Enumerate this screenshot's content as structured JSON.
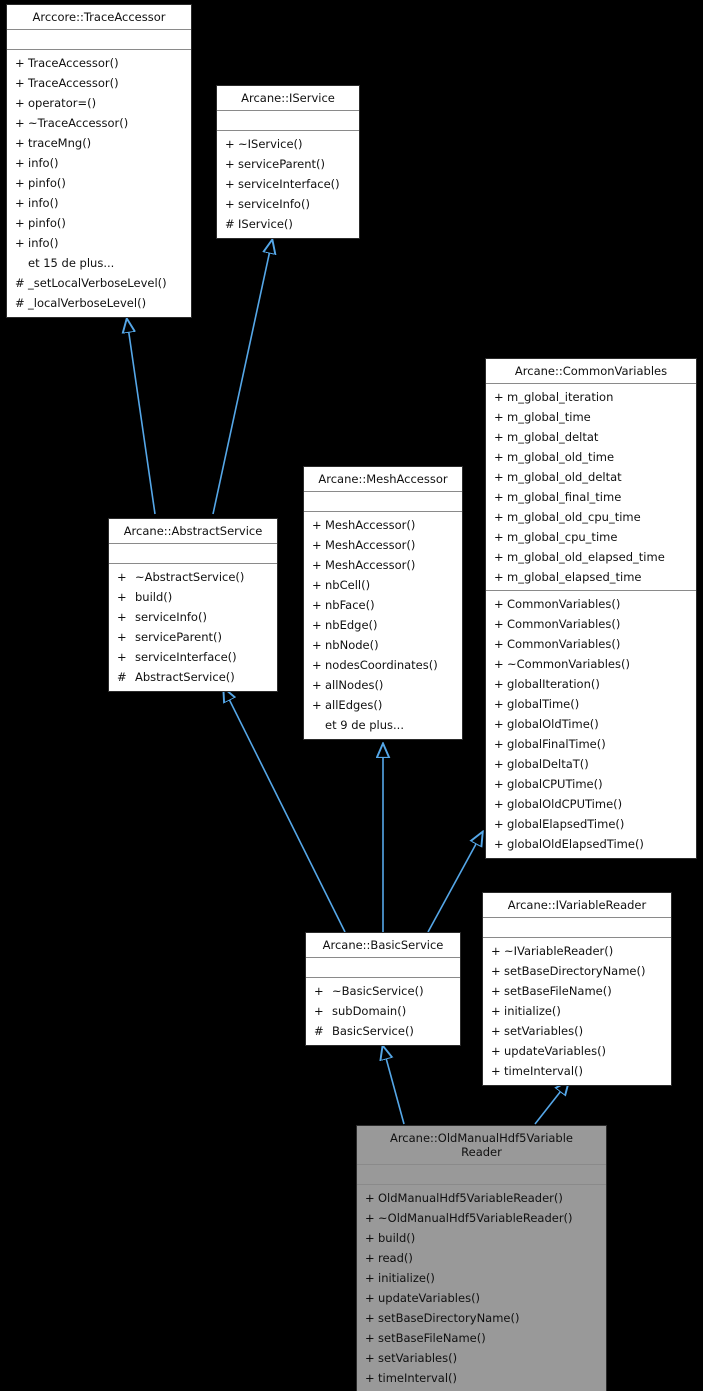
{
  "diagram": {
    "title": "Arcane::OldManualHdf5VariableReader class hierarchy",
    "background_color": "#000000",
    "edge_color": "#55a7e8",
    "box_fill": "#ffffff",
    "highlight_fill": "#999999",
    "more_label_15": "et 15 de plus...",
    "more_label_9": "et 9 de plus..."
  },
  "classes": {
    "trace_accessor": {
      "name": "Arccore::TraceAccessor",
      "attributes": [],
      "operations": [
        {
          "vis": "+",
          "label": "TraceAccessor()"
        },
        {
          "vis": "+",
          "label": "TraceAccessor()"
        },
        {
          "vis": "+",
          "label": "operator=()"
        },
        {
          "vis": "+",
          "label": "~TraceAccessor()"
        },
        {
          "vis": "+",
          "label": "traceMng()"
        },
        {
          "vis": "+",
          "label": "info()"
        },
        {
          "vis": "+",
          "label": "pinfo()"
        },
        {
          "vis": "+",
          "label": "info()"
        },
        {
          "vis": "+",
          "label": "pinfo()"
        },
        {
          "vis": "+",
          "label": "info()"
        },
        {
          "vis": "",
          "label": "et 15 de plus..."
        },
        {
          "vis": "#",
          "label": "_setLocalVerboseLevel()"
        },
        {
          "vis": "#",
          "label": "_localVerboseLevel()"
        }
      ]
    },
    "iservice": {
      "name": "Arcane::IService",
      "attributes": [],
      "operations": [
        {
          "vis": "+",
          "label": "~IService()"
        },
        {
          "vis": "+",
          "label": "serviceParent()"
        },
        {
          "vis": "+",
          "label": "serviceInterface()"
        },
        {
          "vis": "+",
          "label": "serviceInfo()"
        },
        {
          "vis": "#",
          "label": "IService()"
        }
      ]
    },
    "common_variables": {
      "name": "Arcane::CommonVariables",
      "attributes": [
        {
          "vis": "+",
          "label": "m_global_iteration"
        },
        {
          "vis": "+",
          "label": "m_global_time"
        },
        {
          "vis": "+",
          "label": "m_global_deltat"
        },
        {
          "vis": "+",
          "label": "m_global_old_time"
        },
        {
          "vis": "+",
          "label": "m_global_old_deltat"
        },
        {
          "vis": "+",
          "label": "m_global_final_time"
        },
        {
          "vis": "+",
          "label": "m_global_old_cpu_time"
        },
        {
          "vis": "+",
          "label": "m_global_cpu_time"
        },
        {
          "vis": "+",
          "label": "m_global_old_elapsed_time"
        },
        {
          "vis": "+",
          "label": "m_global_elapsed_time"
        }
      ],
      "operations": [
        {
          "vis": "+",
          "label": "CommonVariables()"
        },
        {
          "vis": "+",
          "label": "CommonVariables()"
        },
        {
          "vis": "+",
          "label": "CommonVariables()"
        },
        {
          "vis": "+",
          "label": "~CommonVariables()"
        },
        {
          "vis": "+",
          "label": "globalIteration()"
        },
        {
          "vis": "+",
          "label": "globalTime()"
        },
        {
          "vis": "+",
          "label": "globalOldTime()"
        },
        {
          "vis": "+",
          "label": "globalFinalTime()"
        },
        {
          "vis": "+",
          "label": "globalDeltaT()"
        },
        {
          "vis": "+",
          "label": "globalCPUTime()"
        },
        {
          "vis": "+",
          "label": "globalOldCPUTime()"
        },
        {
          "vis": "+",
          "label": "globalElapsedTime()"
        },
        {
          "vis": "+",
          "label": "globalOldElapsedTime()"
        }
      ]
    },
    "mesh_accessor": {
      "name": "Arcane::MeshAccessor",
      "attributes": [],
      "operations": [
        {
          "vis": "+",
          "label": "MeshAccessor()"
        },
        {
          "vis": "+",
          "label": "MeshAccessor()"
        },
        {
          "vis": "+",
          "label": "MeshAccessor()"
        },
        {
          "vis": "+",
          "label": "nbCell()"
        },
        {
          "vis": "+",
          "label": "nbFace()"
        },
        {
          "vis": "+",
          "label": "nbEdge()"
        },
        {
          "vis": "+",
          "label": "nbNode()"
        },
        {
          "vis": "+",
          "label": "nodesCoordinates()"
        },
        {
          "vis": "+",
          "label": "allNodes()"
        },
        {
          "vis": "+",
          "label": "allEdges()"
        },
        {
          "vis": "",
          "label": "et 9 de plus..."
        }
      ]
    },
    "abstract_service": {
      "name": "Arcane::AbstractService",
      "attributes": [],
      "operations": [
        {
          "vis": "+",
          "label": "~AbstractService()"
        },
        {
          "vis": "+",
          "label": "build()"
        },
        {
          "vis": "+",
          "label": "serviceInfo()"
        },
        {
          "vis": "+",
          "label": "serviceParent()"
        },
        {
          "vis": "+",
          "label": "serviceInterface()"
        },
        {
          "vis": "#",
          "label": "AbstractService()"
        }
      ]
    },
    "basic_service": {
      "name": "Arcane::BasicService",
      "attributes": [],
      "operations": [
        {
          "vis": "+",
          "label": "~BasicService()"
        },
        {
          "vis": "+",
          "label": "subDomain()"
        },
        {
          "vis": "#",
          "label": "BasicService()"
        }
      ]
    },
    "ivariable_reader": {
      "name": "Arcane::IVariableReader",
      "attributes": [],
      "operations": [
        {
          "vis": "+",
          "label": "~IVariableReader()"
        },
        {
          "vis": "+",
          "label": "setBaseDirectoryName()"
        },
        {
          "vis": "+",
          "label": "setBaseFileName()"
        },
        {
          "vis": "+",
          "label": "initialize()"
        },
        {
          "vis": "+",
          "label": "setVariables()"
        },
        {
          "vis": "+",
          "label": "updateVariables()"
        },
        {
          "vis": "+",
          "label": "timeInterval()"
        }
      ]
    },
    "old_manual_hdf5_variable_reader": {
      "name": "Arcane::OldManualHdf5Variable\nReader",
      "attributes": [],
      "operations": [
        {
          "vis": "+",
          "label": "OldManualHdf5VariableReader()"
        },
        {
          "vis": "+",
          "label": "~OldManualHdf5VariableReader()"
        },
        {
          "vis": "+",
          "label": "build()"
        },
        {
          "vis": "+",
          "label": "read()"
        },
        {
          "vis": "+",
          "label": "initialize()"
        },
        {
          "vis": "+",
          "label": "updateVariables()"
        },
        {
          "vis": "+",
          "label": "setBaseDirectoryName()"
        },
        {
          "vis": "+",
          "label": "setBaseFileName()"
        },
        {
          "vis": "+",
          "label": "setVariables()"
        },
        {
          "vis": "+",
          "label": "timeInterval()"
        }
      ]
    }
  },
  "inheritance_edges": [
    {
      "from": "abstract_service",
      "to": "trace_accessor"
    },
    {
      "from": "abstract_service",
      "to": "iservice"
    },
    {
      "from": "basic_service",
      "to": "abstract_service"
    },
    {
      "from": "basic_service",
      "to": "mesh_accessor"
    },
    {
      "from": "basic_service",
      "to": "common_variables"
    },
    {
      "from": "old_manual_hdf5_variable_reader",
      "to": "basic_service"
    },
    {
      "from": "old_manual_hdf5_variable_reader",
      "to": "ivariable_reader"
    }
  ]
}
